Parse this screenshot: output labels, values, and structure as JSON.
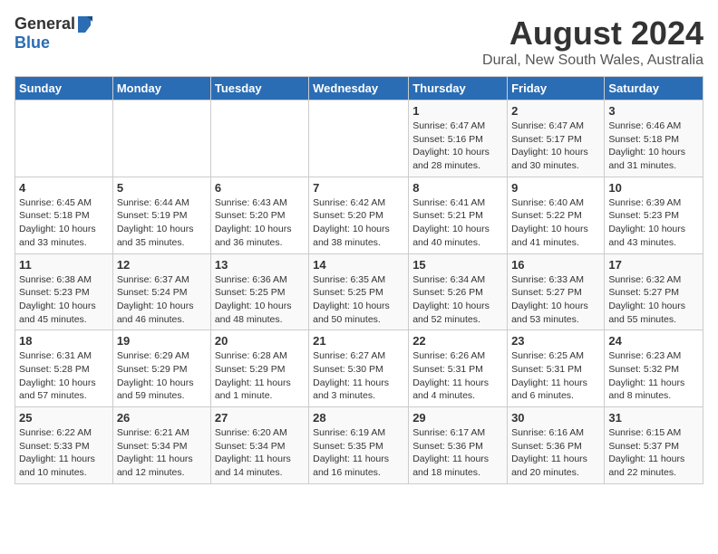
{
  "header": {
    "logo_general": "General",
    "logo_blue": "Blue",
    "title": "August 2024",
    "subtitle": "Dural, New South Wales, Australia"
  },
  "calendar": {
    "days_of_week": [
      "Sunday",
      "Monday",
      "Tuesday",
      "Wednesday",
      "Thursday",
      "Friday",
      "Saturday"
    ],
    "weeks": [
      [
        {
          "day": "",
          "info": ""
        },
        {
          "day": "",
          "info": ""
        },
        {
          "day": "",
          "info": ""
        },
        {
          "day": "",
          "info": ""
        },
        {
          "day": "1",
          "info": "Sunrise: 6:47 AM\nSunset: 5:16 PM\nDaylight: 10 hours\nand 28 minutes."
        },
        {
          "day": "2",
          "info": "Sunrise: 6:47 AM\nSunset: 5:17 PM\nDaylight: 10 hours\nand 30 minutes."
        },
        {
          "day": "3",
          "info": "Sunrise: 6:46 AM\nSunset: 5:18 PM\nDaylight: 10 hours\nand 31 minutes."
        }
      ],
      [
        {
          "day": "4",
          "info": "Sunrise: 6:45 AM\nSunset: 5:18 PM\nDaylight: 10 hours\nand 33 minutes."
        },
        {
          "day": "5",
          "info": "Sunrise: 6:44 AM\nSunset: 5:19 PM\nDaylight: 10 hours\nand 35 minutes."
        },
        {
          "day": "6",
          "info": "Sunrise: 6:43 AM\nSunset: 5:20 PM\nDaylight: 10 hours\nand 36 minutes."
        },
        {
          "day": "7",
          "info": "Sunrise: 6:42 AM\nSunset: 5:20 PM\nDaylight: 10 hours\nand 38 minutes."
        },
        {
          "day": "8",
          "info": "Sunrise: 6:41 AM\nSunset: 5:21 PM\nDaylight: 10 hours\nand 40 minutes."
        },
        {
          "day": "9",
          "info": "Sunrise: 6:40 AM\nSunset: 5:22 PM\nDaylight: 10 hours\nand 41 minutes."
        },
        {
          "day": "10",
          "info": "Sunrise: 6:39 AM\nSunset: 5:23 PM\nDaylight: 10 hours\nand 43 minutes."
        }
      ],
      [
        {
          "day": "11",
          "info": "Sunrise: 6:38 AM\nSunset: 5:23 PM\nDaylight: 10 hours\nand 45 minutes."
        },
        {
          "day": "12",
          "info": "Sunrise: 6:37 AM\nSunset: 5:24 PM\nDaylight: 10 hours\nand 46 minutes."
        },
        {
          "day": "13",
          "info": "Sunrise: 6:36 AM\nSunset: 5:25 PM\nDaylight: 10 hours\nand 48 minutes."
        },
        {
          "day": "14",
          "info": "Sunrise: 6:35 AM\nSunset: 5:25 PM\nDaylight: 10 hours\nand 50 minutes."
        },
        {
          "day": "15",
          "info": "Sunrise: 6:34 AM\nSunset: 5:26 PM\nDaylight: 10 hours\nand 52 minutes."
        },
        {
          "day": "16",
          "info": "Sunrise: 6:33 AM\nSunset: 5:27 PM\nDaylight: 10 hours\nand 53 minutes."
        },
        {
          "day": "17",
          "info": "Sunrise: 6:32 AM\nSunset: 5:27 PM\nDaylight: 10 hours\nand 55 minutes."
        }
      ],
      [
        {
          "day": "18",
          "info": "Sunrise: 6:31 AM\nSunset: 5:28 PM\nDaylight: 10 hours\nand 57 minutes."
        },
        {
          "day": "19",
          "info": "Sunrise: 6:29 AM\nSunset: 5:29 PM\nDaylight: 10 hours\nand 59 minutes."
        },
        {
          "day": "20",
          "info": "Sunrise: 6:28 AM\nSunset: 5:29 PM\nDaylight: 11 hours\nand 1 minute."
        },
        {
          "day": "21",
          "info": "Sunrise: 6:27 AM\nSunset: 5:30 PM\nDaylight: 11 hours\nand 3 minutes."
        },
        {
          "day": "22",
          "info": "Sunrise: 6:26 AM\nSunset: 5:31 PM\nDaylight: 11 hours\nand 4 minutes."
        },
        {
          "day": "23",
          "info": "Sunrise: 6:25 AM\nSunset: 5:31 PM\nDaylight: 11 hours\nand 6 minutes."
        },
        {
          "day": "24",
          "info": "Sunrise: 6:23 AM\nSunset: 5:32 PM\nDaylight: 11 hours\nand 8 minutes."
        }
      ],
      [
        {
          "day": "25",
          "info": "Sunrise: 6:22 AM\nSunset: 5:33 PM\nDaylight: 11 hours\nand 10 minutes."
        },
        {
          "day": "26",
          "info": "Sunrise: 6:21 AM\nSunset: 5:34 PM\nDaylight: 11 hours\nand 12 minutes."
        },
        {
          "day": "27",
          "info": "Sunrise: 6:20 AM\nSunset: 5:34 PM\nDaylight: 11 hours\nand 14 minutes."
        },
        {
          "day": "28",
          "info": "Sunrise: 6:19 AM\nSunset: 5:35 PM\nDaylight: 11 hours\nand 16 minutes."
        },
        {
          "day": "29",
          "info": "Sunrise: 6:17 AM\nSunset: 5:36 PM\nDaylight: 11 hours\nand 18 minutes."
        },
        {
          "day": "30",
          "info": "Sunrise: 6:16 AM\nSunset: 5:36 PM\nDaylight: 11 hours\nand 20 minutes."
        },
        {
          "day": "31",
          "info": "Sunrise: 6:15 AM\nSunset: 5:37 PM\nDaylight: 11 hours\nand 22 minutes."
        }
      ]
    ]
  }
}
